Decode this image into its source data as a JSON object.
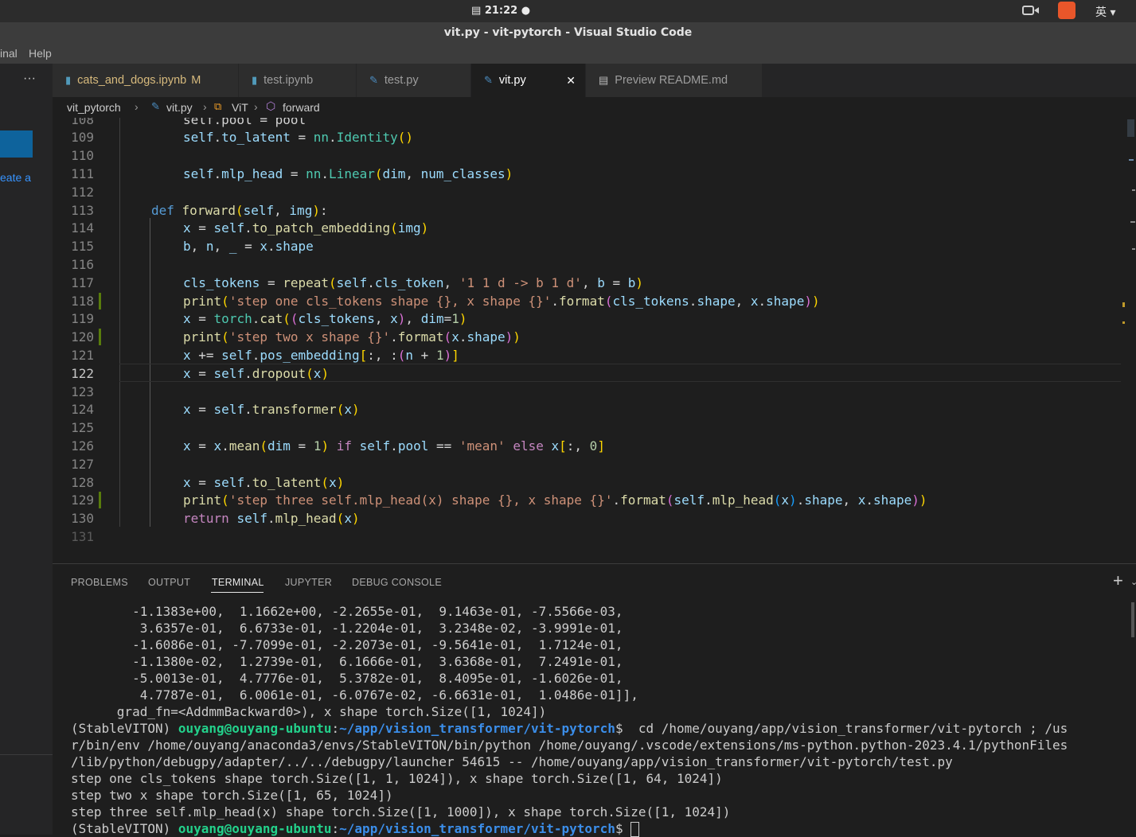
{
  "os": {
    "clock": "21:22",
    "input_method": "英"
  },
  "window": {
    "title": "vit.py - vit-pytorch - Visual Studio Code"
  },
  "menu": [
    "inal",
    "Help"
  ],
  "left_panel": {
    "more": "···",
    "snippet": "eate a"
  },
  "tabs": [
    {
      "label": "cats_and_dogs.ipynb",
      "badge": "M",
      "active": false
    },
    {
      "label": "test.ipynb",
      "active": false
    },
    {
      "label": "test.py",
      "active": false
    },
    {
      "label": "vit.py",
      "active": true,
      "close": "✕"
    },
    {
      "label": "Preview README.md",
      "active": false
    }
  ],
  "breadcrumb": [
    "vit_pytorch",
    "vit.py",
    "ViT",
    "forward"
  ],
  "line_numbers": [
    "108",
    "109",
    "110",
    "111",
    "112",
    "113",
    "114",
    "115",
    "116",
    "117",
    "118",
    "119",
    "120",
    "121",
    "122",
    "123",
    "124",
    "125",
    "126",
    "127",
    "128",
    "129",
    "130",
    "131"
  ],
  "panel_tabs": [
    "PROBLEMS",
    "OUTPUT",
    "TERMINAL",
    "JUPYTER",
    "DEBUG CONSOLE"
  ],
  "active_panel_tab": "TERMINAL",
  "terminal": {
    "tensor_lines": [
      "        -1.1383e+00,  1.1662e+00, -2.2655e-01,  9.1463e-01, -7.5566e-03,",
      "         3.6357e-01,  6.6733e-01, -1.2204e-01,  3.2348e-02, -3.9991e-01,",
      "        -1.6086e-01, -7.7099e-01, -2.2073e-01, -9.5641e-01,  1.7124e-01,",
      "        -1.1380e-02,  1.2739e-01,  6.1666e-01,  3.6368e-01,  7.2491e-01,",
      "        -5.0013e-01,  4.7776e-01,  5.3782e-01,  8.4095e-01, -1.6026e-01,",
      "         4.7787e-01,  6.0061e-01, -6.0767e-02, -6.6631e-01,  1.0486e-01]],",
      "      grad_fn=<AddmmBackward0>), x shape torch.Size([1, 1024])"
    ],
    "prompt_env": "(StableVITON) ",
    "prompt_user": "ouyang@ouyang-ubuntu",
    "prompt_path": "~/app/vision_transformer/vit-pytorch",
    "command_1": "$  cd /home/ouyang/app/vision_transformer/vit-pytorch ; /us",
    "command_2": "r/bin/env /home/ouyang/anaconda3/envs/StableVITON/bin/python /home/ouyang/.vscode/extensions/ms-python.python-2023.4.1/pythonFiles",
    "command_3": "/lib/python/debugpy/adapter/../../debugpy/launcher 54615 -- /home/ouyang/app/vision_transformer/vit-pytorch/test.py",
    "output_lines": [
      "step one cls_tokens shape torch.Size([1, 1, 1024]), x shape torch.Size([1, 64, 1024])",
      "step two x shape torch.Size([1, 65, 1024])",
      "step three self.mlp_head(x) shape torch.Size([1, 1000]), x shape torch.Size([1, 1024])"
    ],
    "final_prompt_suffix": "$ "
  }
}
